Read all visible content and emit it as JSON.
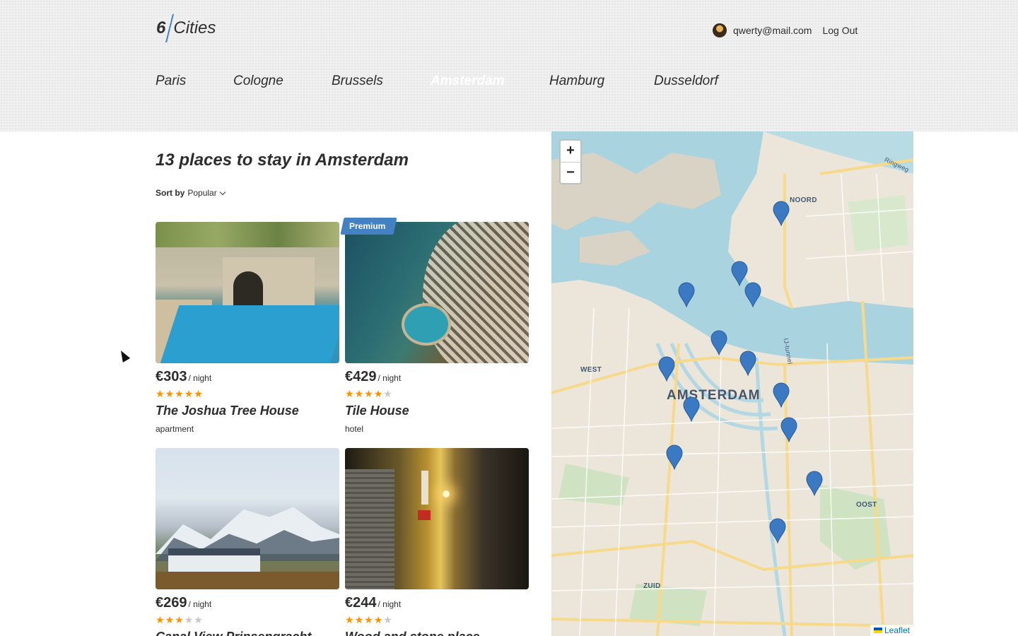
{
  "header": {
    "logo_number": "6",
    "logo_text": "Cities",
    "user_email": "qwerty@mail.com",
    "logout_label": "Log Out"
  },
  "tabs": [
    {
      "label": "Paris",
      "active": false
    },
    {
      "label": "Cologne",
      "active": false
    },
    {
      "label": "Brussels",
      "active": false
    },
    {
      "label": "Amsterdam",
      "active": true
    },
    {
      "label": "Hamburg",
      "active": false
    },
    {
      "label": "Dusseldorf",
      "active": false
    }
  ],
  "places": {
    "title": "13 places to stay in Amsterdam",
    "sort_label": "Sort by",
    "sort_value": "Popular"
  },
  "cards": [
    {
      "price": "€303",
      "per": "/ night",
      "rating": 5,
      "name": "The Joshua Tree House",
      "type": "apartment",
      "premium": false,
      "image": "pool-courtyard"
    },
    {
      "price": "€429",
      "per": "/ night",
      "rating": 4,
      "name": "Tile House",
      "type": "hotel",
      "premium": true,
      "premium_label": "Premium",
      "image": "hotel-aerial"
    },
    {
      "price": "€269",
      "per": "/ night",
      "rating": 3,
      "name": "Canal View Prinsengracht",
      "type": "",
      "premium": false,
      "image": "mountain-house"
    },
    {
      "price": "€244",
      "per": "/ night",
      "rating": 4,
      "name": "Wood and stone place",
      "type": "",
      "premium": false,
      "image": "night-alley"
    }
  ],
  "map": {
    "zoom_in": "+",
    "zoom_out": "−",
    "attribution": "Leaflet",
    "labels": {
      "noord": "NOORD",
      "west": "WEST",
      "amsterdam": "AMSTERDAM",
      "oost": "OOST",
      "zuid": "ZUID",
      "ij_tunnel": "IJ-tunnel",
      "ringweg": "Ringweg"
    },
    "pin_color": "#3b79c3",
    "accent": "#4481c3"
  }
}
